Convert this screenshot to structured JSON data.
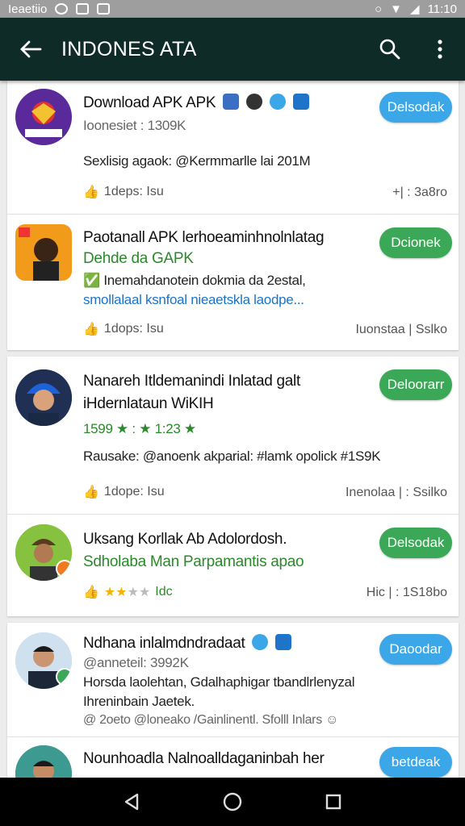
{
  "status_bar": {
    "left_text": "Ieaetiio",
    "time": "11:10"
  },
  "app_bar": {
    "title": "INDONES ATA"
  },
  "colors": {
    "app_bar": "#0f2b27",
    "button_blue": "#3ba7e8",
    "button_green": "#3aa857",
    "link_blue": "#1a73c8",
    "accent_green": "#2a8a2a"
  },
  "items": [
    {
      "name": "Download APK APK",
      "sub": "Ioonesiet : 1309K",
      "desc": "Sexlisig agaok: @Kermmarlle lai 201M",
      "likes": "1deps: Isu",
      "right": "+| : 3a8ro",
      "button": "Delsodak"
    },
    {
      "name": "Paotanall APK lerhoeaminhnolnlatag",
      "sub": "Dehde da GAPK",
      "desc": "Inemahdanotein dokmia da 2estal,",
      "desc2": "smollalaal ksnfoal nieaetskla laodpe...",
      "likes": "1dops: Isu",
      "right": "Iuonstaa | Sslko",
      "button": "Dcionek"
    },
    {
      "name": "Nanareh Itldemanindi Inlatad galt",
      "name2": "iHdernlataun WiKIH",
      "sub": "1599 ★ : ★ 1:23 ★",
      "desc": "Rausake: @anoenk akparial: #lamk opolick #1S9K",
      "likes": "1dope: Isu",
      "right": "Inenolaa | : Ssilko",
      "button": "Deloorarr"
    },
    {
      "name": "Uksang Korllak Ab Adolordosh.",
      "name2": "Sdholaba Man Parpamantis apao",
      "rating_text": "Idc",
      "right": "Hic | : 1S18bo",
      "button": "Delsodak"
    },
    {
      "name": "Ndhana inlalmdndradaat",
      "sub": "@anneteil: 3992K",
      "desc": "Horsda laolehtan, Gdalhaphigar tbandlrlenyzal",
      "desc2": "Ihreninbain Jaetek.",
      "foot": "@ 2oeto @loneako /Gainlinentl. Sfolll Inlars",
      "button": "Daoodar"
    },
    {
      "name": "Nounhoadla Nalnoalldaganinbah her",
      "button": "betdeak"
    }
  ]
}
